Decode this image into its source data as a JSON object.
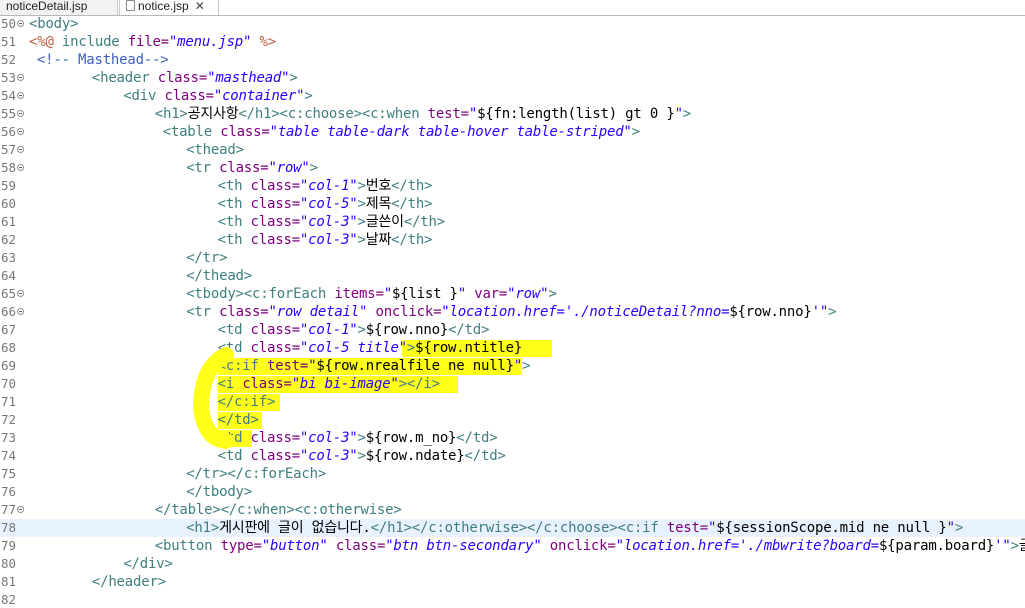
{
  "tabs": [
    {
      "label": "noticeDetail.jsp"
    },
    {
      "label": "notice.jsp",
      "close": "✕"
    }
  ],
  "editor": {
    "current_line": 78,
    "highlight_color": "#ffff1a",
    "lines": [
      {
        "n": "50",
        "fold": true,
        "indent": 0,
        "segs": [
          [
            "t",
            "<body>"
          ]
        ]
      },
      {
        "n": "51",
        "fold": false,
        "indent": 0,
        "segs": [
          [
            "dir",
            "<%@ "
          ],
          [
            "t",
            "include "
          ],
          [
            "a",
            "file="
          ],
          [
            "v",
            "\"menu.jsp\""
          ],
          [
            "dir",
            " %>"
          ]
        ]
      },
      {
        "n": "52",
        "fold": false,
        "indent": 1,
        "segs": [
          [
            "d",
            "<!-- Masthead-->"
          ]
        ]
      },
      {
        "n": "53",
        "fold": true,
        "indent": 8,
        "segs": [
          [
            "t",
            "<header "
          ],
          [
            "a",
            "class="
          ],
          [
            "v",
            "\"masthead\""
          ],
          [
            "t",
            ">"
          ]
        ]
      },
      {
        "n": "54",
        "fold": true,
        "indent": 12,
        "segs": [
          [
            "t",
            "<div "
          ],
          [
            "a",
            "class="
          ],
          [
            "v",
            "\"container\""
          ],
          [
            "t",
            ">"
          ]
        ]
      },
      {
        "n": "55",
        "fold": true,
        "indent": 16,
        "segs": [
          [
            "t",
            "<h1>"
          ],
          [
            "tx",
            "공지사항"
          ],
          [
            "t",
            "</h1><c:choose><c:when "
          ],
          [
            "a",
            "test="
          ],
          [
            "v",
            "\""
          ],
          [
            "tx",
            "${fn:length(list) gt 0 }"
          ],
          [
            "v",
            "\""
          ],
          [
            "t",
            ">"
          ]
        ]
      },
      {
        "n": "56",
        "fold": true,
        "indent": 17,
        "segs": [
          [
            "t",
            "<table "
          ],
          [
            "a",
            "class="
          ],
          [
            "v",
            "\"table table-dark table-hover table-striped\""
          ],
          [
            "t",
            ">"
          ]
        ]
      },
      {
        "n": "57",
        "fold": true,
        "indent": 20,
        "segs": [
          [
            "t",
            "<thead>"
          ]
        ]
      },
      {
        "n": "58",
        "fold": true,
        "indent": 20,
        "segs": [
          [
            "t",
            "<tr "
          ],
          [
            "a",
            "class="
          ],
          [
            "v",
            "\"row\""
          ],
          [
            "t",
            ">"
          ]
        ]
      },
      {
        "n": "59",
        "fold": false,
        "indent": 24,
        "segs": [
          [
            "t",
            "<th "
          ],
          [
            "a",
            "class="
          ],
          [
            "v",
            "\"col-1\""
          ],
          [
            "t",
            ">"
          ],
          [
            "tx",
            "번호"
          ],
          [
            "t",
            "</th>"
          ]
        ]
      },
      {
        "n": "60",
        "fold": false,
        "indent": 24,
        "segs": [
          [
            "t",
            "<th "
          ],
          [
            "a",
            "class="
          ],
          [
            "v",
            "\"col-5\""
          ],
          [
            "t",
            ">"
          ],
          [
            "tx",
            "제목"
          ],
          [
            "t",
            "</th>"
          ]
        ]
      },
      {
        "n": "61",
        "fold": false,
        "indent": 24,
        "segs": [
          [
            "t",
            "<th "
          ],
          [
            "a",
            "class="
          ],
          [
            "v",
            "\"col-3\""
          ],
          [
            "t",
            ">"
          ],
          [
            "tx",
            "글쓴이"
          ],
          [
            "t",
            "</th>"
          ]
        ]
      },
      {
        "n": "62",
        "fold": false,
        "indent": 24,
        "segs": [
          [
            "t",
            "<th "
          ],
          [
            "a",
            "class="
          ],
          [
            "v",
            "\"col-3\""
          ],
          [
            "t",
            ">"
          ],
          [
            "tx",
            "날짜"
          ],
          [
            "t",
            "</th>"
          ]
        ]
      },
      {
        "n": "63",
        "fold": false,
        "indent": 20,
        "segs": [
          [
            "t",
            "</tr>"
          ]
        ]
      },
      {
        "n": "64",
        "fold": false,
        "indent": 20,
        "segs": [
          [
            "t",
            "</thead>"
          ]
        ]
      },
      {
        "n": "65",
        "fold": true,
        "indent": 20,
        "segs": [
          [
            "t",
            "<tbody><c:forEach "
          ],
          [
            "a",
            "items="
          ],
          [
            "v",
            "\""
          ],
          [
            "tx",
            "${list }"
          ],
          [
            "v",
            "\""
          ],
          [
            "a",
            " var="
          ],
          [
            "v",
            "\"row\""
          ],
          [
            "t",
            ">"
          ]
        ]
      },
      {
        "n": "66",
        "fold": true,
        "indent": 20,
        "segs": [
          [
            "t",
            "<tr "
          ],
          [
            "a",
            "class="
          ],
          [
            "v",
            "\"row detail\""
          ],
          [
            "a",
            " onclick="
          ],
          [
            "v",
            "\"location.href='./noticeDetail?nno="
          ],
          [
            "tx",
            "${row.nno}"
          ],
          [
            "v",
            "'\""
          ],
          [
            "t",
            ">"
          ]
        ]
      },
      {
        "n": "67",
        "fold": false,
        "indent": 24,
        "segs": [
          [
            "t",
            "<td "
          ],
          [
            "a",
            "class="
          ],
          [
            "v",
            "\"col-1\""
          ],
          [
            "t",
            ">"
          ],
          [
            "tx",
            "${row.nno}"
          ],
          [
            "t",
            "</td>"
          ]
        ]
      },
      {
        "n": "68",
        "fold": false,
        "indent": 24,
        "segs": [
          [
            "t",
            "<td "
          ],
          [
            "a",
            "class="
          ],
          [
            "v",
            "\"col-5 title\""
          ],
          [
            "t",
            ">"
          ],
          [
            "tx",
            "${row.ntitle}"
          ]
        ]
      },
      {
        "n": "69",
        "fold": false,
        "indent": 24,
        "segs": [
          [
            "t",
            "<c:if "
          ],
          [
            "a",
            "test="
          ],
          [
            "v",
            "\""
          ],
          [
            "tx",
            "${row.nrealfile ne null}"
          ],
          [
            "v",
            "\""
          ],
          [
            "t",
            ">"
          ]
        ]
      },
      {
        "n": "70",
        "fold": false,
        "indent": 24,
        "segs": [
          [
            "t",
            "<i "
          ],
          [
            "a",
            "class="
          ],
          [
            "v",
            "\"bi bi-image\""
          ],
          [
            "t",
            "></i>"
          ]
        ]
      },
      {
        "n": "71",
        "fold": false,
        "indent": 24,
        "segs": [
          [
            "t",
            "</c:if>"
          ]
        ]
      },
      {
        "n": "72",
        "fold": false,
        "indent": 24,
        "segs": [
          [
            "t",
            "</td>"
          ]
        ]
      },
      {
        "n": "73",
        "fold": false,
        "indent": 24,
        "segs": [
          [
            "t",
            "<td "
          ],
          [
            "a",
            "class="
          ],
          [
            "v",
            "\"col-3\""
          ],
          [
            "t",
            ">"
          ],
          [
            "tx",
            "${row.m_no}"
          ],
          [
            "t",
            "</td>"
          ]
        ]
      },
      {
        "n": "74",
        "fold": false,
        "indent": 24,
        "segs": [
          [
            "t",
            "<td "
          ],
          [
            "a",
            "class="
          ],
          [
            "v",
            "\"col-3\""
          ],
          [
            "t",
            ">"
          ],
          [
            "tx",
            "${row.ndate}"
          ],
          [
            "t",
            "</td>"
          ]
        ]
      },
      {
        "n": "75",
        "fold": false,
        "indent": 20,
        "segs": [
          [
            "t",
            "</tr></c:forEach>"
          ]
        ]
      },
      {
        "n": "76",
        "fold": false,
        "indent": 20,
        "segs": [
          [
            "t",
            "</tbody>"
          ]
        ]
      },
      {
        "n": "77",
        "fold": true,
        "indent": 16,
        "segs": [
          [
            "t",
            "</table></c:when><c:otherwise>"
          ]
        ]
      },
      {
        "n": "78",
        "fold": false,
        "indent": 20,
        "segs": [
          [
            "t",
            "<h1>"
          ],
          [
            "tx",
            "게시판에 글이 없습니다."
          ],
          [
            "t",
            "</h1></c:otherwise></c:choose><c:if "
          ],
          [
            "a",
            "test="
          ],
          [
            "v",
            "\""
          ],
          [
            "tx",
            "${sessionScope.mid ne null }"
          ],
          [
            "v",
            "\""
          ],
          [
            "t",
            ">"
          ]
        ]
      },
      {
        "n": "79",
        "fold": false,
        "indent": 16,
        "segs": [
          [
            "t",
            "<button "
          ],
          [
            "a",
            "type="
          ],
          [
            "v",
            "\"button\""
          ],
          [
            "a",
            " class="
          ],
          [
            "v",
            "\"btn btn-secondary\""
          ],
          [
            "a",
            " onclick="
          ],
          [
            "v",
            "\"location.href='./mbwrite?board="
          ],
          [
            "tx",
            "${param.board}"
          ],
          [
            "v",
            "'\""
          ],
          [
            "t",
            ">"
          ],
          [
            "tx",
            "글쓰기"
          ]
        ]
      },
      {
        "n": "80",
        "fold": false,
        "indent": 12,
        "segs": [
          [
            "t",
            "</div>"
          ]
        ]
      },
      {
        "n": "81",
        "fold": false,
        "indent": 8,
        "segs": [
          [
            "t",
            "</header>"
          ]
        ]
      },
      {
        "n": "82",
        "fold": false,
        "indent": 0,
        "segs": []
      }
    ]
  }
}
